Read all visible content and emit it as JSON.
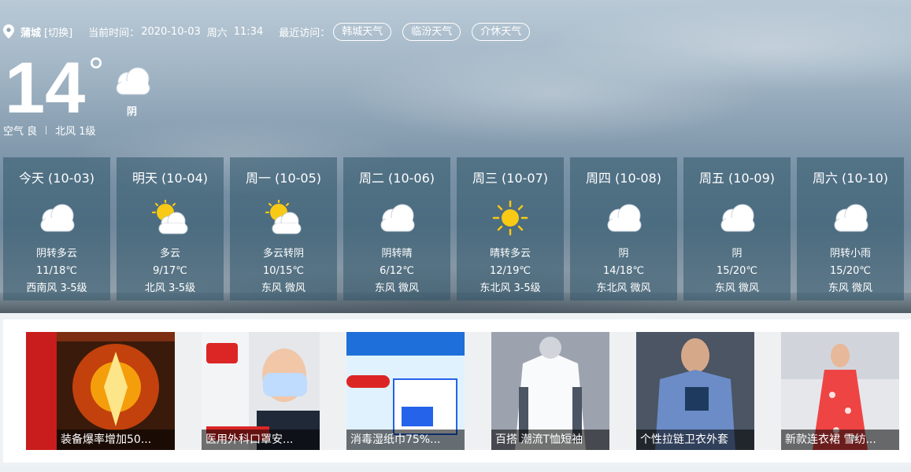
{
  "header": {
    "city": "蒲城",
    "switch_label": "[切换]",
    "time_label": "当前时间：",
    "date": "2020-10-03",
    "weekday": "周六",
    "clock": "11:34",
    "recent_label": "最近访问：",
    "recent": [
      "韩城天气",
      "临汾天气",
      "介休天气"
    ]
  },
  "current": {
    "temp": "14",
    "degree_symbol": "°",
    "condition": "阴",
    "icon": "cloud-icon",
    "air_quality": "空气 良",
    "wind": "北风 1级"
  },
  "forecast": [
    {
      "title": "今天 (10-03)",
      "icon": "cloud-icon",
      "desc": "阴转多云",
      "temp": "11/18℃",
      "wind": "西南风 3-5级"
    },
    {
      "title": "明天 (10-04)",
      "icon": "partly-cloudy-icon",
      "desc": "多云",
      "temp": "9/17℃",
      "wind": "北风 3-5级"
    },
    {
      "title": "周一 (10-05)",
      "icon": "partly-cloudy-icon",
      "desc": "多云转阴",
      "temp": "10/15℃",
      "wind": "东风 微风"
    },
    {
      "title": "周二 (10-06)",
      "icon": "cloud-icon",
      "desc": "阴转晴",
      "temp": "6/12℃",
      "wind": "东风 微风"
    },
    {
      "title": "周三 (10-07)",
      "icon": "sun-icon",
      "desc": "晴转多云",
      "temp": "12/19℃",
      "wind": "东北风 3-5级"
    },
    {
      "title": "周四 (10-08)",
      "icon": "cloud-icon",
      "desc": "阴",
      "temp": "14/18℃",
      "wind": "东北风 微风"
    },
    {
      "title": "周五 (10-09)",
      "icon": "cloud-icon",
      "desc": "阴",
      "temp": "15/20℃",
      "wind": "东风 微风"
    },
    {
      "title": "周六 (10-10)",
      "icon": "cloud-icon",
      "desc": "阴转小雨",
      "temp": "15/20℃",
      "wind": "东风 微风"
    }
  ],
  "ads": [
    {
      "caption": "装备爆率增加50..."
    },
    {
      "caption": "医用外科口罩安..."
    },
    {
      "caption": "消毒湿纸巾75%..."
    },
    {
      "caption": "百搭 潮流T恤短袖"
    },
    {
      "caption": "个性拉链卫衣外套"
    },
    {
      "caption": "新款连衣裙 雪纺..."
    }
  ],
  "colors": {
    "card_bg": "#2f5569",
    "sun": "#f8c915",
    "cloud": "#ffffff"
  }
}
